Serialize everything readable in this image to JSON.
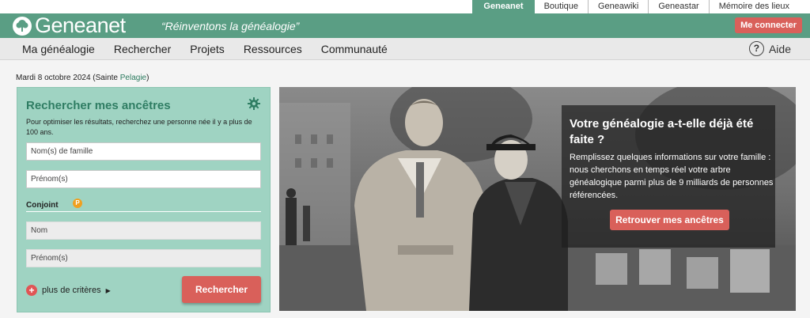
{
  "topbar": {
    "links": [
      "Geneanet",
      "Boutique",
      "Geneawiki",
      "Geneastar",
      "Mémoire des lieux"
    ]
  },
  "header": {
    "logo_text": "Geneanet",
    "tagline": "“Réinventons la généalogie”",
    "login_label": "Me connecter"
  },
  "nav": {
    "items": [
      "Ma généalogie",
      "Rechercher",
      "Projets",
      "Ressources",
      "Communauté"
    ],
    "help_label": "Aide",
    "help_symbol": "?"
  },
  "date": {
    "prefix": "Mardi 8 octobre 2024 (Sainte",
    "saint": "Pelagie",
    "suffix": ")"
  },
  "search_panel": {
    "title": "Rechercher mes ancêtres",
    "description": "Pour optimiser les résultats, recherchez une personne née il y a plus de 100 ans.",
    "surname_placeholder": "Nom(s) de famille",
    "firstname_placeholder": "Prénom(s)",
    "spouse_label": "Conjoint",
    "premium_badge": "P",
    "spouse_surname_placeholder": "Nom",
    "spouse_firstname_placeholder": "Prénom(s)",
    "more_criteria_label": "plus de critères",
    "search_button_label": "Rechercher"
  },
  "hero": {
    "title": "Votre généalogie a-t-elle déjà été faite ?",
    "text": "Remplissez quelques informations sur votre famille : nous cherchons en temps réel votre arbre généalogique parmi plus de 9 milliards de personnes référencées.",
    "button_label": "Retrouver mes ancêtres"
  },
  "colors": {
    "brand": "#5a9e84",
    "panel": "#9fd3c2",
    "accent": "#d9605a"
  }
}
